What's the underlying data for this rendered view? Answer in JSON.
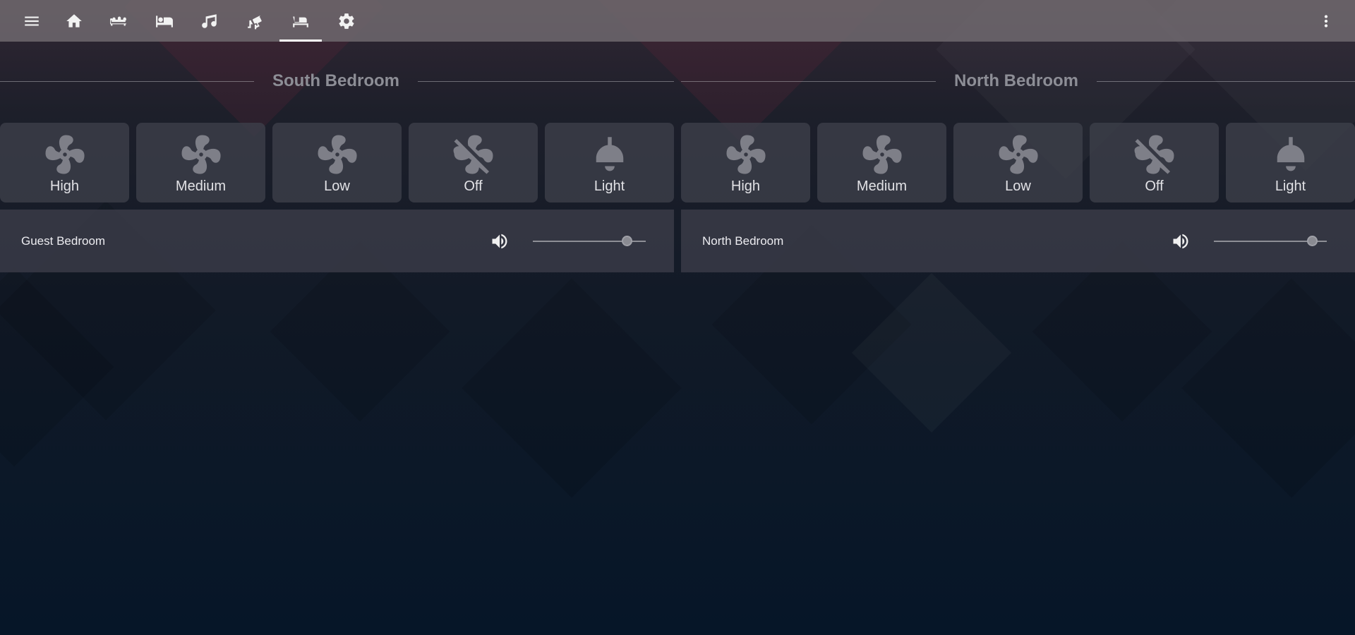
{
  "toolbar": {
    "tabs": [
      {
        "icon": "home-icon",
        "name": "home"
      },
      {
        "icon": "sofa-icon",
        "name": "living-room"
      },
      {
        "icon": "bed-icon",
        "name": "bedroom-1"
      },
      {
        "icon": "music-icon",
        "name": "music"
      },
      {
        "icon": "cctv-icon",
        "name": "cameras"
      },
      {
        "icon": "bed-empty-icon",
        "name": "bedrooms",
        "active": true
      },
      {
        "icon": "gear-icon",
        "name": "settings"
      }
    ]
  },
  "sections": {
    "south": {
      "title": "South Bedroom",
      "buttons": {
        "high": "High",
        "medium": "Medium",
        "low": "Low",
        "off": "Off",
        "light": "Light"
      },
      "media": {
        "name": "Guest Bedroom",
        "volume": 0.83
      }
    },
    "north": {
      "title": "North Bedroom",
      "buttons": {
        "high": "High",
        "medium": "Medium",
        "low": "Low",
        "off": "Off",
        "light": "Light"
      },
      "media": {
        "name": "North Bedroom",
        "volume": 0.87
      }
    }
  },
  "colors": {
    "toolbar": "#6e686e",
    "tile": "#3e404a",
    "icon": "#7e7f88",
    "section_title": "#8d8e96"
  }
}
